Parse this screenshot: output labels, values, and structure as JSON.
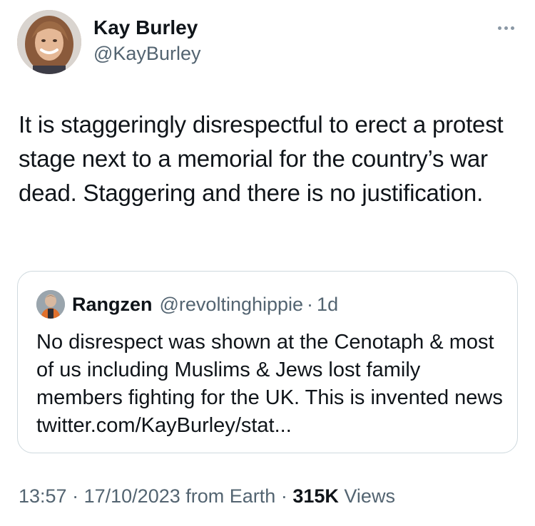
{
  "author": {
    "display_name": "Kay Burley",
    "handle": "@KayBurley"
  },
  "tweet": {
    "text": "It is staggeringly disrespectful to erect a protest stage next to a memorial for the country’s war dead.  Staggering and there is no justification."
  },
  "quoted_tweet": {
    "display_name": "Rangzen",
    "handle": "@revoltinghippie",
    "separator": "·",
    "age": "1d",
    "text": "No disrespect was shown at the Cenotaph & most of us including Muslims & Jews lost family members fighting for the UK. This is invented news twitter.com/KayBurley/stat..."
  },
  "meta": {
    "time": "13:57",
    "separator": "·",
    "date": "17/10/2023",
    "source": "from Earth",
    "views_count": "315K",
    "views_label": "Views"
  },
  "icons": {
    "more": "more-horizontal-icon"
  },
  "colors": {
    "text_primary": "#0f1419",
    "text_secondary": "#536471",
    "border": "#cfd9de"
  }
}
